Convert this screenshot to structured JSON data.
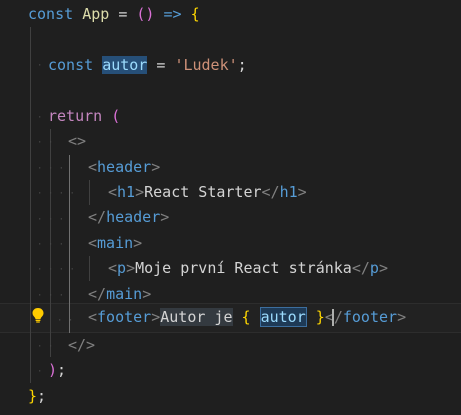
{
  "editor": {
    "lines": {
      "l1": {
        "const": "const",
        "name": "App",
        "eq": "=",
        "parens": "()",
        "arrow": "=>",
        "brace": "{"
      },
      "l3": {
        "const": "const",
        "name": "autor",
        "eq": "=",
        "value": "'Ludek'",
        "semi": ";"
      },
      "l5": {
        "return": "return",
        "paren": "("
      },
      "l6": {
        "fragment_open": "<>"
      },
      "l7": {
        "lt": "<",
        "tag": "header",
        "gt": ">"
      },
      "l8": {
        "lt": "<",
        "tag": "h1",
        "gt": ">",
        "text": "React Starter",
        "close_lt": "</",
        "close_tag": "h1",
        "close_gt": ">"
      },
      "l9": {
        "close_lt": "</",
        "tag": "header",
        "gt": ">"
      },
      "l10": {
        "lt": "<",
        "tag": "main",
        "gt": ">"
      },
      "l11": {
        "lt": "<",
        "tag": "p",
        "gt": ">",
        "text": "Moje první React stránka",
        "close_lt": "</",
        "close_tag": "p",
        "close_gt": ">"
      },
      "l12": {
        "close_lt": "</",
        "tag": "main",
        "gt": ">"
      },
      "l13": {
        "lt": "<",
        "tag": "footer",
        "gt": ">",
        "text": "Autor je",
        "expr_open": "{",
        "expr_var": "autor",
        "expr_close": "}",
        "close_lt": "</",
        "close_tag": "footer",
        "close_gt": ">"
      },
      "l14": {
        "fragment_close": "</>"
      },
      "l15": {
        "paren": ")",
        "semi": ";"
      },
      "l16": {
        "brace": "}",
        "semi": ";"
      }
    },
    "icons": {
      "lightbulb": "lightbulb-icon"
    },
    "colors": {
      "background": "#1f1f1f",
      "keyword": "#569cd6",
      "control": "#c586c0",
      "variable": "#9cdcfe",
      "string": "#ce9178",
      "bracket_gold": "#ffd700",
      "bracket_orchid": "#da70d6",
      "bracket_blue": "#179fff",
      "selection": "#264f78"
    }
  }
}
